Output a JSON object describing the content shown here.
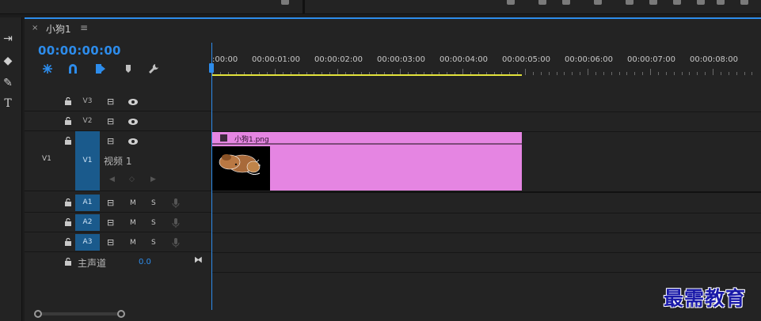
{
  "window": {
    "tab_close": "×",
    "tab_title": "小狗1",
    "tab_menu": "≡"
  },
  "timecode": "00:00:00:00",
  "ruler": {
    "labels": [
      ":00:00",
      "00:00:01:00",
      "00:00:02:00",
      "00:00:03:00",
      "00:00:04:00",
      "00:00:05:00",
      "00:00:06:00",
      "00:00:07:00",
      "00:00:08:00"
    ]
  },
  "tracks": {
    "v3": {
      "name": "V3"
    },
    "v2": {
      "name": "V2"
    },
    "v1": {
      "source": "V1",
      "name": "V1",
      "label": "视频 1"
    },
    "a1": {
      "name": "A1",
      "m": "M",
      "s": "S"
    },
    "a2": {
      "name": "A2",
      "m": "M",
      "s": "S"
    },
    "a3": {
      "name": "A3",
      "m": "M",
      "s": "S"
    },
    "master": {
      "label": "主声道",
      "value": "0.0"
    }
  },
  "clip": {
    "name": "小狗1.png",
    "color": "#e585e2"
  },
  "colors": {
    "accent": "#2d8ceb",
    "work_area": "#e3e33b",
    "track_target": "#1a5a8c"
  },
  "watermark": "最需教育"
}
